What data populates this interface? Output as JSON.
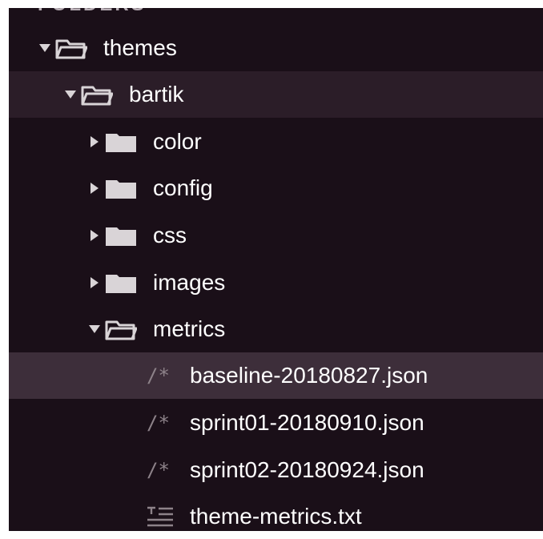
{
  "sidebar": {
    "header": "FOLDERS",
    "items": [
      {
        "label": "themes",
        "depth": 0,
        "kind": "folder",
        "expanded": true
      },
      {
        "label": "bartik",
        "depth": 1,
        "kind": "folder",
        "expanded": true
      },
      {
        "label": "color",
        "depth": 2,
        "kind": "folder",
        "expanded": false
      },
      {
        "label": "config",
        "depth": 2,
        "kind": "folder",
        "expanded": false
      },
      {
        "label": "css",
        "depth": 2,
        "kind": "folder",
        "expanded": false
      },
      {
        "label": "images",
        "depth": 2,
        "kind": "folder",
        "expanded": false
      },
      {
        "label": "metrics",
        "depth": 2,
        "kind": "folder",
        "expanded": true
      },
      {
        "label": "baseline-20180827.json",
        "depth": 3,
        "kind": "json-file",
        "icon_text": "/*"
      },
      {
        "label": "sprint01-20180910.json",
        "depth": 3,
        "kind": "json-file",
        "icon_text": "/*"
      },
      {
        "label": "sprint02-20180924.json",
        "depth": 3,
        "kind": "json-file",
        "icon_text": "/*"
      },
      {
        "label": "theme-metrics.txt",
        "depth": 3,
        "kind": "text-file"
      }
    ]
  },
  "colors": {
    "background": "#1a0f18",
    "selected_row": "#3d2e3a",
    "parent_row": "#2b1d28",
    "text": "#ffffff",
    "icon": "#d9d4d7",
    "muted": "#8d8289"
  }
}
